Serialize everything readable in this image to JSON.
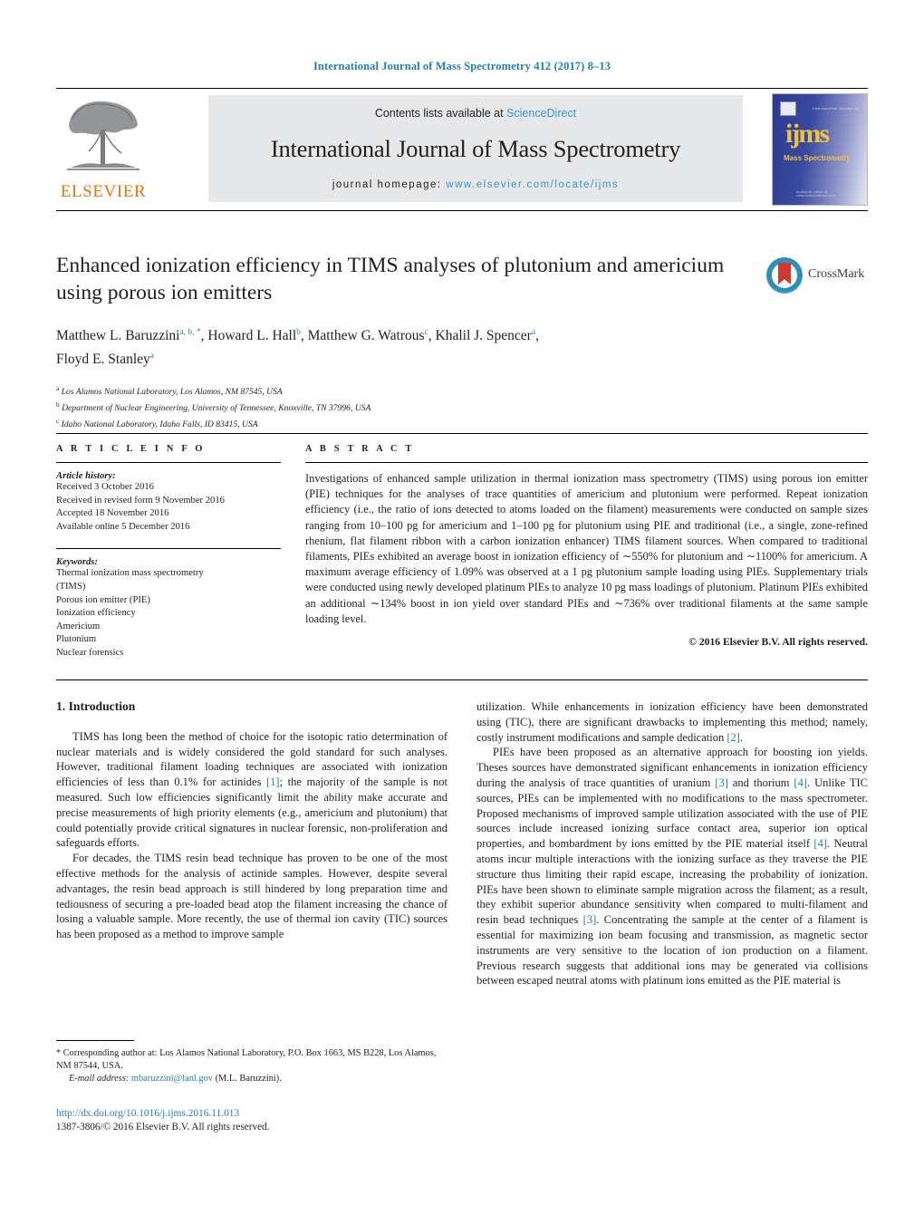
{
  "running_head": "International Journal of Mass Spectrometry 412 (2017) 8–13",
  "masthead": {
    "contents_prefix": "Contents lists available at ",
    "contents_link": "ScienceDirect",
    "journal_title": "International Journal of Mass Spectrometry",
    "homepage_prefix": "journal homepage: ",
    "homepage_url": "www.elsevier.com/locate/ijms",
    "publisher_wordmark": "ELSEVIER",
    "cover_title": "ijms",
    "cover_subtitle": "Mass Spectrometry",
    "cover_top_text": "International Journal of",
    "cover_bottom_text": "Available online at www.sciencedirect.com"
  },
  "crossmark": {
    "label": "CrossMark"
  },
  "article": {
    "title": "Enhanced ionization efficiency in TIMS analyses of plutonium and americium using porous ion emitters",
    "authors_line1_parts": [
      {
        "text": "Matthew L. Baruzzini",
        "sup": "a, b, *"
      },
      {
        "text": ", Howard L. Hall",
        "sup": "b"
      },
      {
        "text": ", Matthew G. Watrous",
        "sup": "c"
      },
      {
        "text": ", Khalil J. Spencer",
        "sup": "a"
      },
      {
        "text": ",",
        "sup": ""
      }
    ],
    "authors_line2_parts": [
      {
        "text": "Floyd E. Stanley",
        "sup": "a"
      }
    ],
    "affiliations": [
      {
        "mark": "a",
        "text": "Los Alamos National Laboratory, Los Alamos, NM 87545, USA"
      },
      {
        "mark": "b",
        "text": "Department of Nuclear Engineering, University of Tennessee, Knoxville, TN 37996, USA"
      },
      {
        "mark": "c",
        "text": "Idaho National Laboratory, Idaho Falls, ID 83415, USA"
      }
    ]
  },
  "article_info": {
    "heading": "A R T I C L E   I N F O",
    "history_label": "Article history:",
    "history": [
      "Received 3 October 2016",
      "Received in revised form 9 November 2016",
      "Accepted 18 November 2016",
      "Available online 5 December 2016"
    ],
    "keywords_label": "Keywords:",
    "keywords": [
      "Thermal ionization mass spectrometry",
      "(TIMS)",
      "Porous ion emitter (PIE)",
      "Ionization efficiency",
      "Americium",
      "Plutonium",
      "Nuclear forensics"
    ]
  },
  "abstract": {
    "heading": "A B S T R A C T",
    "text": "Investigations of enhanced sample utilization in thermal ionization mass spectrometry (TIMS) using porous ion emitter (PIE) techniques for the analyses of trace quantities of americium and plutonium were performed. Repeat ionization efficiency (i.e., the ratio of ions detected to atoms loaded on the filament) measurements were conducted on sample sizes ranging from 10–100 pg for americium and 1–100 pg for plutonium using PIE and traditional (i.e., a single, zone-refined rhenium, flat filament ribbon with a carbon ionization enhancer) TIMS filament sources. When compared to traditional filaments, PIEs exhibited an average boost in ionization efficiency of ∼550% for plutonium and ∼1100% for americium. A maximum average efficiency of 1.09% was observed at a 1 pg plutonium sample loading using PIEs. Supplementary trials were conducted using newly developed platinum PIEs to analyze 10 pg mass loadings of plutonium. Platinum PIEs exhibited an additional ∼134% boost in ion yield over standard PIEs and ∼736% over traditional filaments at the same sample loading level.",
    "copyright": "© 2016 Elsevier B.V. All rights reserved."
  },
  "body": {
    "section_number_title": "1.  Introduction",
    "left_paragraphs": [
      {
        "segments": [
          {
            "t": "TIMS has long been the method of choice for the isotopic ratio determination of nuclear materials and is widely considered the gold standard for such analyses. However, traditional filament loading techniques are associated with ionization efficiencies of less than 0.1% for actinides ",
            "ref": false
          },
          {
            "t": "[1]",
            "ref": true
          },
          {
            "t": "; the majority of the sample is not measured. Such low efficiencies significantly limit the ability make accurate and precise measurements of high priority elements (e.g., americium and plutonium) that could potentially provide critical signatures in nuclear forensic, non-proliferation and safeguards efforts.",
            "ref": false
          }
        ]
      },
      {
        "segments": [
          {
            "t": "For decades, the TIMS resin bead technique has proven to be one of the most effective methods for the analysis of actinide samples. However, despite several advantages, the resin bead approach is still hindered by long preparation time and tediousness of securing a pre-loaded bead atop the filament increasing the chance of losing a valuable sample. More recently, the use of thermal ion cavity (TIC) sources has been proposed as a method to improve sample",
            "ref": false
          }
        ]
      }
    ],
    "right_paragraphs": [
      {
        "no_indent": true,
        "segments": [
          {
            "t": "utilization. While enhancements in ionization efficiency have been demonstrated using (TIC), there are significant drawbacks to implementing this method; namely, costly instrument modifications and sample dedication ",
            "ref": false
          },
          {
            "t": "[2]",
            "ref": true
          },
          {
            "t": ".",
            "ref": false
          }
        ]
      },
      {
        "segments": [
          {
            "t": "PIEs have been proposed as an alternative approach for boosting ion yields. Theses sources have demonstrated significant enhancements in ionization efficiency during the analysis of trace quantities of uranium ",
            "ref": false
          },
          {
            "t": "[3]",
            "ref": true
          },
          {
            "t": " and thorium ",
            "ref": false
          },
          {
            "t": "[4]",
            "ref": true
          },
          {
            "t": ". Unlike TIC sources, PIEs can be implemented with no modifications to the mass spectrometer. Proposed mechanisms of improved sample utilization associated with the use of PIE sources include increased ionizing surface contact area, superior ion optical properties, and bombardment by ions emitted by the PIE material itself ",
            "ref": false
          },
          {
            "t": "[4]",
            "ref": true
          },
          {
            "t": ". Neutral atoms incur multiple interactions with the ionizing surface as they traverse the PIE structure thus limiting their rapid escape, increasing the probability of ionization. PIEs have been shown to eliminate sample migration across the filament; as a result, they exhibit superior abundance sensitivity when compared to multi-filament and resin bead techniques ",
            "ref": false
          },
          {
            "t": "[3]",
            "ref": true
          },
          {
            "t": ". Concentrating the sample at the center of a filament is essential for maximizing ion beam focusing and transmission, as magnetic sector instruments are very sensitive to the location of ion production on a filament. Previous research suggests that additional ions may be generated via collisions between escaped neutral atoms with platinum ions emitted as the PIE material is",
            "ref": false
          }
        ]
      }
    ]
  },
  "footnote": {
    "star": "*",
    "corresponding": "Corresponding author at: Los Alamos National Laboratory, P.O. Box 1663, MS B228, Los Alamos, NM 87544, USA.",
    "email_label": "E-mail address:",
    "email": "mbaruzzini@lanl.gov",
    "email_owner": "(M.L. Baruzzini)."
  },
  "doi": {
    "url": "http://dx.doi.org/10.1016/j.ijms.2016.11.013",
    "issn_line": "1387-3806/© 2016 Elsevier B.V. All rights reserved."
  },
  "colors": {
    "link_blue": "#1f7fb5",
    "sciencedirect_blue": "#3a97c9",
    "elsevier_orange": "#e8740c",
    "band_gray": "#e6e7e8",
    "crossmark_red": "#d0392f"
  }
}
